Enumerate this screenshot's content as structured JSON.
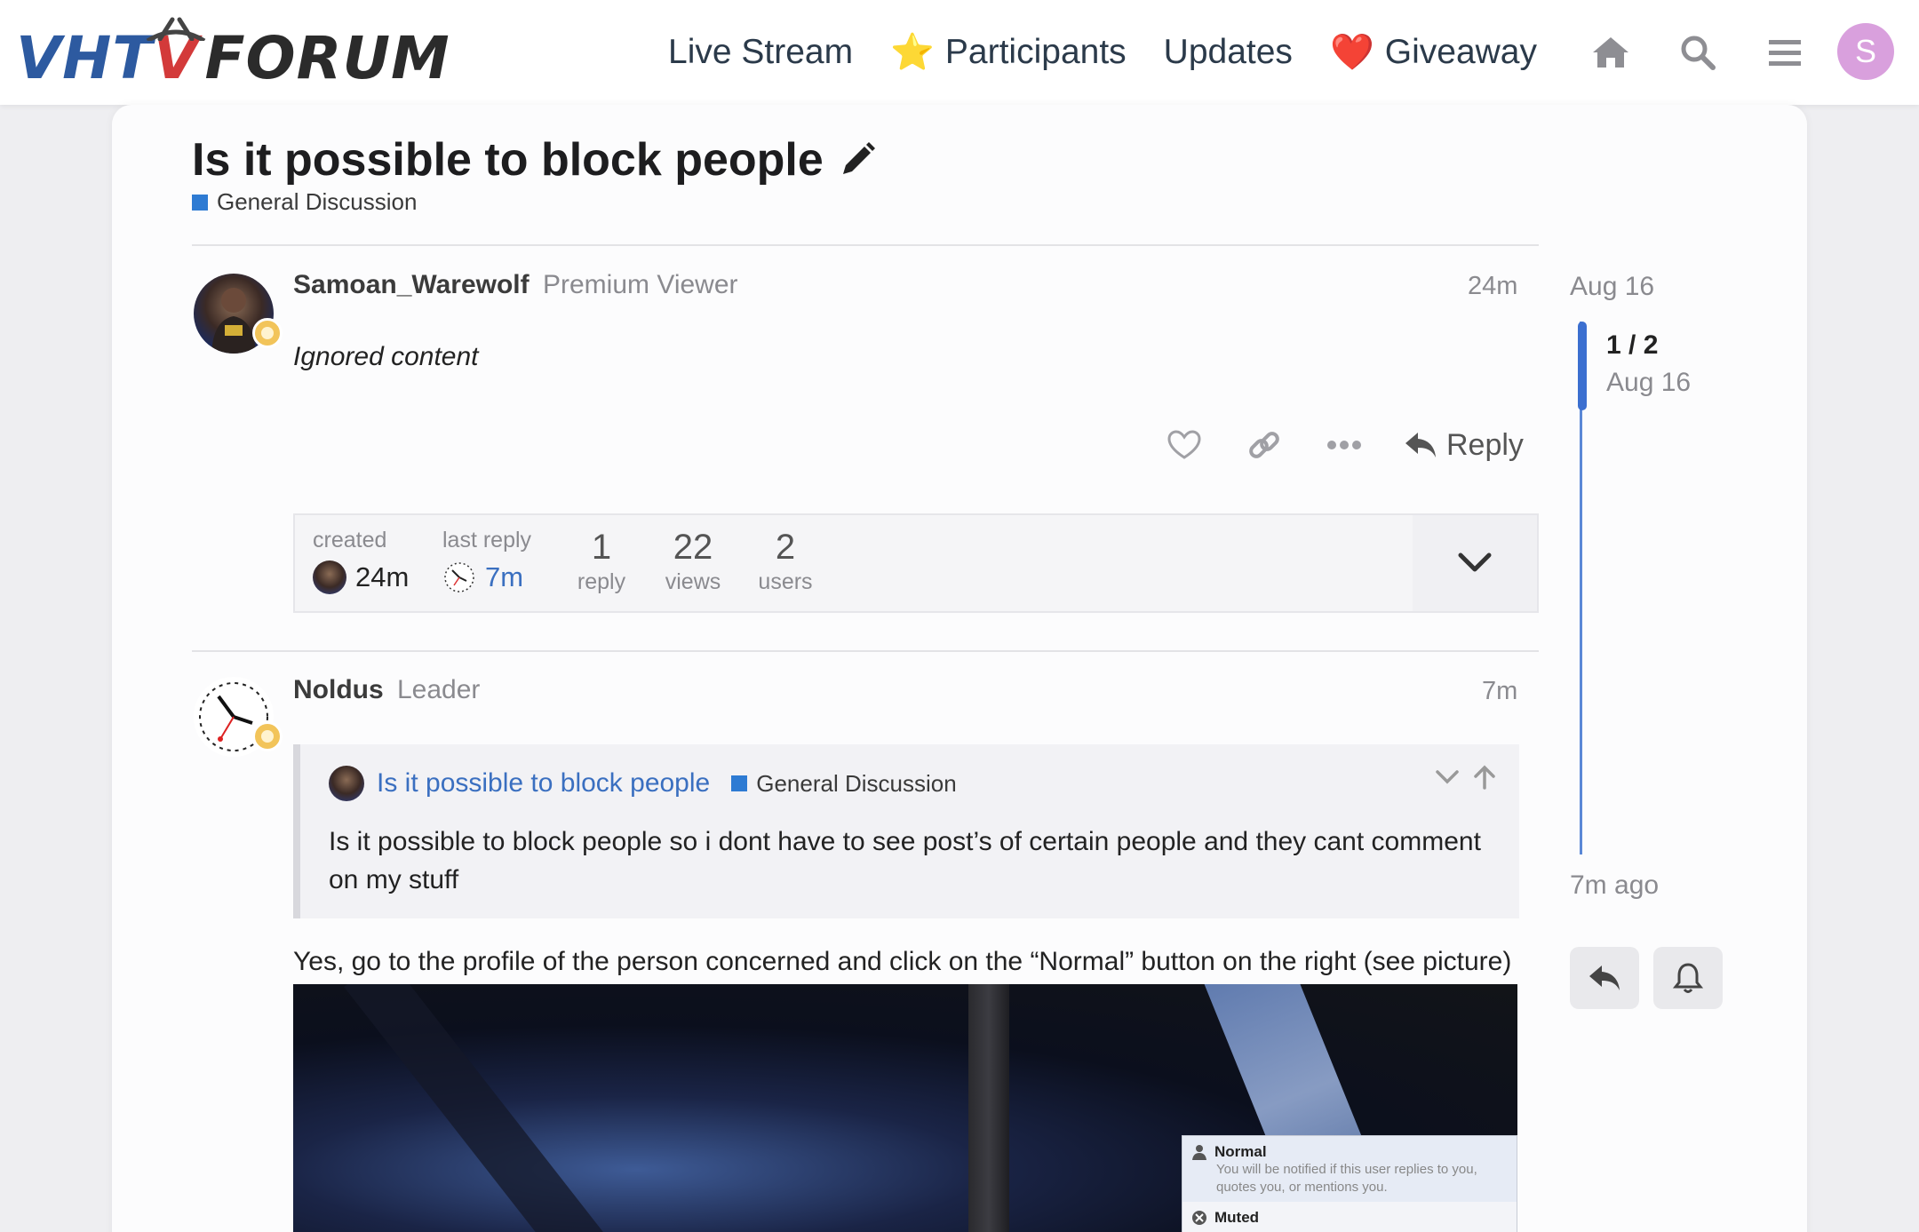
{
  "header": {
    "logo_text": "VHTV FORUM",
    "logo_part1": "VHT",
    "logo_part2": "V",
    "logo_part3": "FORUM",
    "nav": [
      {
        "label": "Live Stream",
        "emoji": ""
      },
      {
        "label": "Participants",
        "emoji": "⭐"
      },
      {
        "label": "Updates",
        "emoji": ""
      },
      {
        "label": "Giveaway",
        "emoji": "❤️"
      }
    ],
    "icons": [
      "home-icon",
      "search-icon",
      "hamburger-menu-icon"
    ],
    "user_initial": "S",
    "avatar_color": "#d9a0dd"
  },
  "topic": {
    "title": "Is it possible to block people",
    "category": "General Discussion",
    "category_color": "#2e7bd3"
  },
  "posts": [
    {
      "username": "Samoan_Warewolf",
      "user_title": "Premium Viewer",
      "time": "24m",
      "content": "Ignored content",
      "reply_label": "Reply"
    },
    {
      "username": "Noldus",
      "user_title": "Leader",
      "time": "7m",
      "quote": {
        "title": "Is it possible to block people",
        "category": "General Discussion",
        "text": "Is it possible to block people so i dont have to see post’s of certain people and they cant comment on my stuff"
      },
      "answer": "Yes, go to the profile of the person concerned and click on the “Normal” button on the right (see picture)",
      "image_popup": {
        "normal_title": "Normal",
        "normal_desc": "You will be notified if this user replies to you, quotes you, or mentions you.",
        "muted_title": "Muted"
      }
    }
  ],
  "topic_meta": {
    "created_label": "created",
    "created_value": "24m",
    "last_reply_label": "last reply",
    "last_reply_value": "7m",
    "replies": "1",
    "replies_label": "reply",
    "views": "22",
    "views_label": "views",
    "users": "2",
    "users_label": "users"
  },
  "timeline": {
    "start_date": "Aug 16",
    "position": "1 / 2",
    "position_date": "Aug 16",
    "end_label": "7m ago"
  },
  "colors": {
    "accent_blue": "#3b6fd0",
    "link_blue": "#3a6fc0",
    "logo_blue": "#2d5aa0",
    "logo_red": "#d33a3a"
  }
}
